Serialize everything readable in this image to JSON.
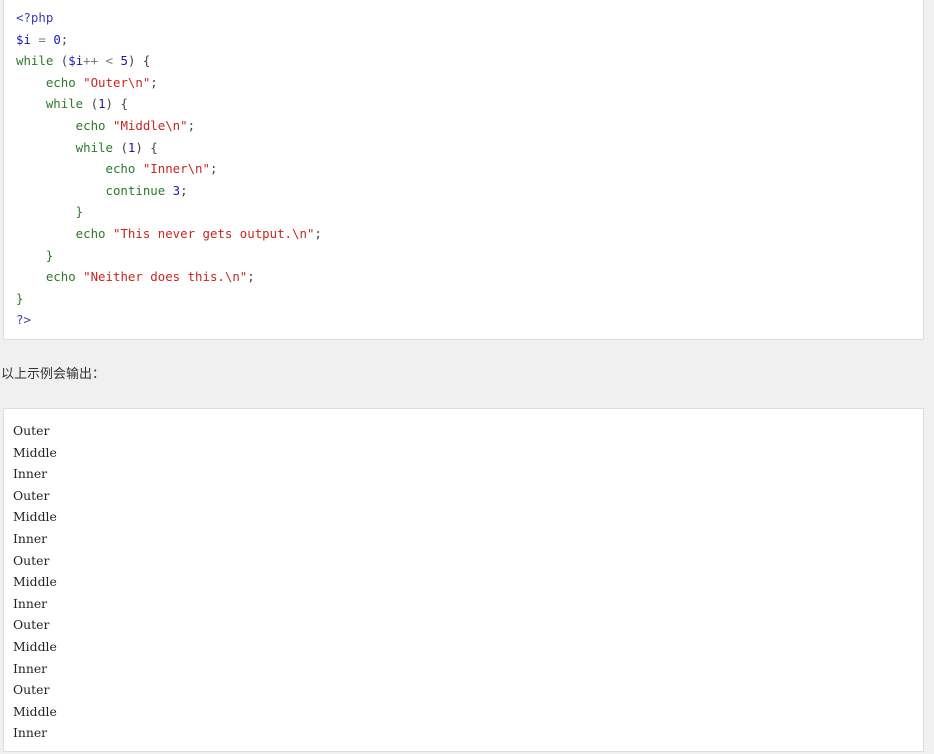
{
  "code": {
    "lines": [
      [
        {
          "t": "<?php",
          "c": "meta"
        }
      ],
      [
        {
          "t": "$i",
          "c": "var"
        },
        {
          "t": " = ",
          "c": "op"
        },
        {
          "t": "0",
          "c": "num"
        },
        {
          "t": ";",
          "c": "pun"
        }
      ],
      [
        {
          "t": "while",
          "c": "kw"
        },
        {
          "t": " (",
          "c": "pun"
        },
        {
          "t": "$i",
          "c": "var"
        },
        {
          "t": "++ < ",
          "c": "op"
        },
        {
          "t": "5",
          "c": "num"
        },
        {
          "t": ") {",
          "c": "pun"
        }
      ],
      [
        {
          "t": "    echo ",
          "c": "kw"
        },
        {
          "t": "\"Outer\\n\"",
          "c": "str"
        },
        {
          "t": ";",
          "c": "pun"
        }
      ],
      [
        {
          "t": "    while",
          "c": "kw"
        },
        {
          "t": " (",
          "c": "pun"
        },
        {
          "t": "1",
          "c": "num"
        },
        {
          "t": ") {",
          "c": "pun"
        }
      ],
      [
        {
          "t": "        echo ",
          "c": "kw"
        },
        {
          "t": "\"Middle\\n\"",
          "c": "str"
        },
        {
          "t": ";",
          "c": "pun"
        }
      ],
      [
        {
          "t": "        while",
          "c": "kw"
        },
        {
          "t": " (",
          "c": "pun"
        },
        {
          "t": "1",
          "c": "num"
        },
        {
          "t": ") {",
          "c": "pun"
        }
      ],
      [
        {
          "t": "            echo ",
          "c": "kw"
        },
        {
          "t": "\"Inner\\n\"",
          "c": "str"
        },
        {
          "t": ";",
          "c": "pun"
        }
      ],
      [
        {
          "t": "            continue ",
          "c": "kw"
        },
        {
          "t": "3",
          "c": "num"
        },
        {
          "t": ";",
          "c": "pun"
        }
      ],
      [
        {
          "t": "        }",
          "c": "kw"
        }
      ],
      [
        {
          "t": "        echo ",
          "c": "kw"
        },
        {
          "t": "\"This never gets output.\\n\"",
          "c": "str"
        },
        {
          "t": ";",
          "c": "pun"
        }
      ],
      [
        {
          "t": "    }",
          "c": "kw"
        }
      ],
      [
        {
          "t": "    echo ",
          "c": "kw"
        },
        {
          "t": "\"Neither does this.\\n\"",
          "c": "str"
        },
        {
          "t": ";",
          "c": "pun"
        }
      ],
      [
        {
          "t": "}",
          "c": "kw"
        }
      ],
      [
        {
          "t": "?>",
          "c": "meta"
        }
      ]
    ]
  },
  "caption": "以上示例会输出：",
  "output": {
    "lines": [
      "Outer",
      "Middle",
      "Inner",
      "Outer",
      "Middle",
      "Inner",
      "Outer",
      "Middle",
      "Inner",
      "Outer",
      "Middle",
      "Inner",
      "Outer",
      "Middle",
      "Inner"
    ]
  }
}
